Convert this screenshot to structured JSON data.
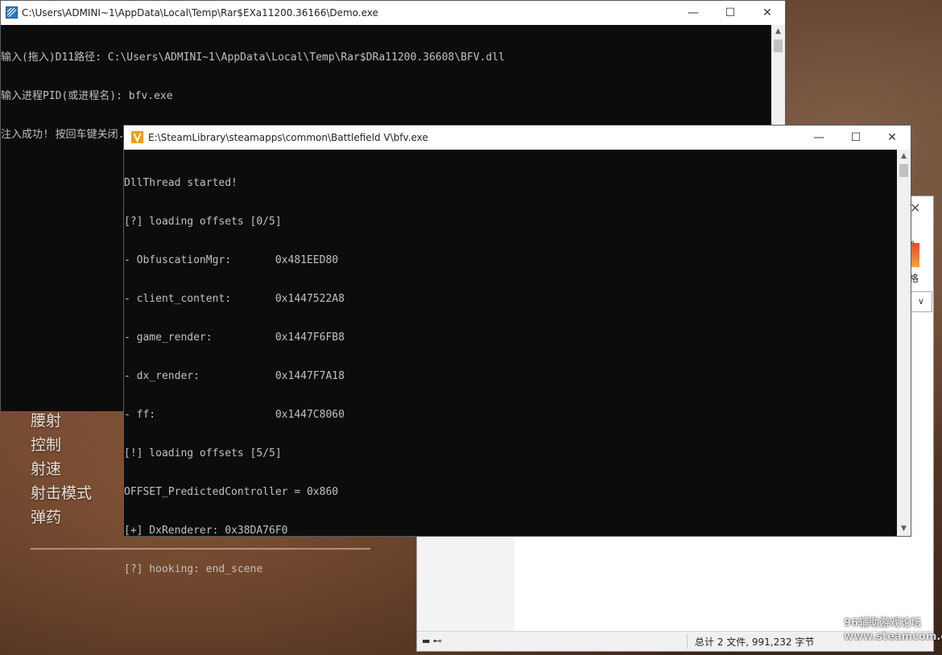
{
  "game_menu": {
    "items": [
      "腰射",
      "控制",
      "射速",
      "射击模式",
      "弹药"
    ]
  },
  "explorer": {
    "ribbon_label": "格",
    "dropdown": "∨",
    "chevron": "»",
    "close": "✕",
    "status_text": "总计 2 文件, 991,232 字节"
  },
  "demo_window": {
    "title": "C:\\Users\\ADMINI~1\\AppData\\Local\\Temp\\Rar$EXa11200.36166\\Demo.exe",
    "lines": [
      "输入(拖入)D11路径: C:\\Users\\ADMINI~1\\AppData\\Local\\Temp\\Rar$DRa11200.36608\\BFV.dll",
      "输入进程PID(或进程名): bfv.exe",
      "注入成功! 按回车键关闭..."
    ]
  },
  "bfv_window": {
    "title": "E:\\SteamLibrary\\steamapps\\common\\Battlefield V\\bfv.exe",
    "lines": [
      "DllThread started!",
      "[?] loading offsets [0/5]",
      "- ObfuscationMgr:       0x481EED80",
      "- client_content:       0x1447522A8",
      "- game_render:          0x1447F6FB8",
      "- dx_render:            0x1447F7A18",
      "- ff:                   0x1447C8060",
      "[!] loading offsets [5/5]",
      "OFFSET_PredictedController = 0x860",
      "[+] DxRenderer: 0x38DA76F0",
      "[?] hooking: end_scene"
    ]
  },
  "watermark": {
    "line1": "96辅助游戏论坛",
    "line2": "www.steamcom.cn"
  },
  "colors": {
    "console_bg": "#0c0c0c",
    "console_text": "#c0c0c0",
    "titlebar_bg": "#ffffff",
    "bfv_icon": "#f39c12"
  },
  "icons": {
    "demo_icon": "console-app-icon",
    "bfv_icon": "v-logo-icon",
    "minimize": "minimize-icon",
    "maximize": "maximize-icon",
    "close": "close-icon"
  }
}
